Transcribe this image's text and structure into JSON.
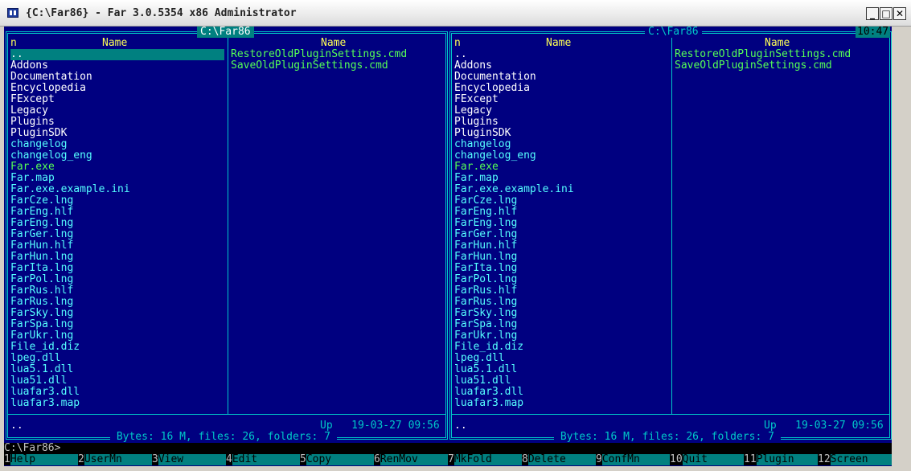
{
  "window": {
    "title": "{C:\\Far86} - Far 3.0.5354 x86 Administrator"
  },
  "left_panel": {
    "path": "C:\\Far86",
    "col1_header": "n",
    "col2_header": "Name",
    "col3_header": "Name",
    "col1_files": [
      "..",
      "Addons",
      "Documentation",
      "Encyclopedia",
      "FExcept",
      "Legacy",
      "Plugins",
      "PluginSDK",
      "changelog",
      "changelog_eng",
      "Far.exe",
      "Far.map",
      "Far.exe.example.ini",
      "FarCze.lng",
      "FarEng.hlf",
      "FarEng.lng",
      "FarGer.lng",
      "FarHun.hlf",
      "FarHun.lng",
      "FarIta.lng",
      "FarPol.lng",
      "FarRus.hlf",
      "FarRus.lng",
      "FarSky.lng",
      "FarSpa.lng",
      "FarUkr.lng",
      "File_id.diz",
      "lpeg.dll",
      "lua5.1.dll",
      "lua51.dll",
      "luafar3.dll",
      "luafar3.map"
    ],
    "col1_colors": [
      "w",
      "w",
      "w",
      "w",
      "w",
      "w",
      "w",
      "w",
      "c",
      "c",
      "g",
      "c",
      "c",
      "c",
      "c",
      "c",
      "c",
      "c",
      "c",
      "c",
      "c",
      "c",
      "c",
      "c",
      "c",
      "c",
      "c",
      "c",
      "c",
      "c",
      "c",
      "c"
    ],
    "col2_files": [
      "RestoreOldPluginSettings.cmd",
      "SaveOldPluginSettings.cmd"
    ],
    "status_name": "..",
    "status_info": "Up   19-03-27 09:56",
    "summary": " Bytes: 16 M, files: 26, folders: 7 "
  },
  "right_panel": {
    "path": "C:\\Far86",
    "clock": "10:47",
    "col1_header": "n",
    "col2_header": "Name",
    "col3_header": "Name",
    "col1_files": [
      "..",
      "Addons",
      "Documentation",
      "Encyclopedia",
      "FExcept",
      "Legacy",
      "Plugins",
      "PluginSDK",
      "changelog",
      "changelog_eng",
      "Far.exe",
      "Far.map",
      "Far.exe.example.ini",
      "FarCze.lng",
      "FarEng.hlf",
      "FarEng.lng",
      "FarGer.lng",
      "FarHun.hlf",
      "FarHun.lng",
      "FarIta.lng",
      "FarPol.lng",
      "FarRus.hlf",
      "FarRus.lng",
      "FarSky.lng",
      "FarSpa.lng",
      "FarUkr.lng",
      "File_id.diz",
      "lpeg.dll",
      "lua5.1.dll",
      "lua51.dll",
      "luafar3.dll",
      "luafar3.map"
    ],
    "col1_colors": [
      "w",
      "w",
      "w",
      "w",
      "w",
      "w",
      "w",
      "w",
      "c",
      "c",
      "g",
      "c",
      "c",
      "c",
      "c",
      "c",
      "c",
      "c",
      "c",
      "c",
      "c",
      "c",
      "c",
      "c",
      "c",
      "c",
      "c",
      "c",
      "c",
      "c",
      "c",
      "c"
    ],
    "col2_files": [
      "RestoreOldPluginSettings.cmd",
      "SaveOldPluginSettings.cmd"
    ],
    "status_name": "..",
    "status_info": "Up   19-03-27 09:56",
    "summary": " Bytes: 16 M, files: 26, folders: 7 "
  },
  "command_line": {
    "prompt": "C:\\Far86>"
  },
  "keybar": [
    {
      "num": "1",
      "label": "Help"
    },
    {
      "num": "2",
      "label": "UserMn"
    },
    {
      "num": "3",
      "label": "View"
    },
    {
      "num": "4",
      "label": "Edit"
    },
    {
      "num": "5",
      "label": "Copy"
    },
    {
      "num": "6",
      "label": "RenMov"
    },
    {
      "num": "7",
      "label": "MkFold"
    },
    {
      "num": "8",
      "label": "Delete"
    },
    {
      "num": "9",
      "label": "ConfMn"
    },
    {
      "num": "10",
      "label": "Quit"
    },
    {
      "num": "11",
      "label": "Plugin"
    },
    {
      "num": "12",
      "label": "Screen"
    }
  ],
  "colors": {
    "background": "#000080",
    "frame": "#00c8c8",
    "directory": "#ffffff",
    "file": "#55ffff",
    "executable": "#55ff55",
    "header": "#ffff55",
    "cursor": "#008080"
  }
}
